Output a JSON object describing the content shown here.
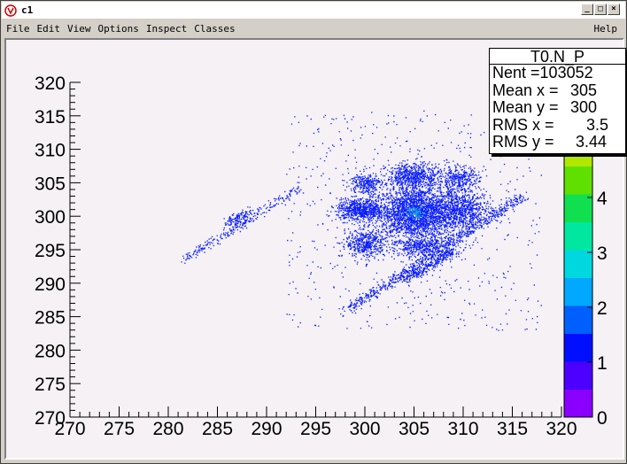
{
  "window": {
    "title": "c1",
    "controls": [
      "_",
      "□",
      "×"
    ]
  },
  "menubar": {
    "items": [
      {
        "label": "File",
        "name": "menu-file"
      },
      {
        "label": "Edit",
        "name": "menu-edit"
      },
      {
        "label": "View",
        "name": "menu-view"
      },
      {
        "label": "Options",
        "name": "menu-options"
      },
      {
        "label": "Inspect",
        "name": "menu-inspect"
      },
      {
        "label": "Classes",
        "name": "menu-classes"
      }
    ],
    "help": "Help"
  },
  "stats": {
    "title": "T0.N_P",
    "rows": [
      {
        "label": "Nent = ",
        "value": "103052"
      },
      {
        "label": "Mean x = ",
        "value": "305"
      },
      {
        "label": "Mean y = ",
        "value": "300"
      },
      {
        "label": "RMS x = ",
        "value": "3.5"
      },
      {
        "label": "RMS y = ",
        "value": "3.44"
      }
    ]
  },
  "colors": {
    "canvas_bg": "#f5f1f5",
    "point_color": "#0a1eff",
    "dense_color": "#1a9fd8"
  },
  "chart_data": {
    "type": "heatmap",
    "title": "",
    "xlabel": "",
    "ylabel": "",
    "xlim": [
      270,
      320
    ],
    "ylim": [
      270,
      320
    ],
    "x_ticks": [
      "270",
      "275",
      "280",
      "285",
      "290",
      "295",
      "300",
      "305",
      "310",
      "315",
      "320"
    ],
    "y_ticks": [
      "270",
      "275",
      "280",
      "285",
      "290",
      "295",
      "300",
      "305",
      "310",
      "315",
      "320"
    ],
    "colorbar": {
      "min": 0,
      "max": 5,
      "ticks": [
        "0",
        "1",
        "2",
        "3",
        "4",
        "5"
      ]
    },
    "grid": false,
    "clusters": [
      {
        "cx": 305.2,
        "cy": 300.5,
        "sx": 2.2,
        "sy": 2.0,
        "n": 2600
      },
      {
        "cx": 299.5,
        "cy": 301.0,
        "sx": 1.2,
        "sy": 0.8,
        "n": 700
      },
      {
        "cx": 305.0,
        "cy": 306.0,
        "sx": 1.4,
        "sy": 1.0,
        "n": 650
      },
      {
        "cx": 309.5,
        "cy": 305.5,
        "sx": 1.0,
        "sy": 1.0,
        "n": 350
      },
      {
        "cx": 300.0,
        "cy": 296.0,
        "sx": 1.0,
        "sy": 1.0,
        "n": 420
      },
      {
        "cx": 310.0,
        "cy": 301.0,
        "sx": 1.4,
        "sy": 1.3,
        "n": 650
      },
      {
        "cx": 300.0,
        "cy": 305.0,
        "sx": 0.8,
        "sy": 0.8,
        "n": 250
      },
      {
        "cx": 306.0,
        "cy": 295.5,
        "sx": 1.8,
        "sy": 0.8,
        "n": 500
      }
    ],
    "streaks": [
      {
        "x1": 281.5,
        "y1": 293.5,
        "x2": 293.5,
        "y2": 304.5,
        "n": 260
      },
      {
        "x1": 286.0,
        "y1": 299.0,
        "x2": 288.5,
        "y2": 301.0,
        "n": 120
      },
      {
        "x1": 298.0,
        "y1": 286.0,
        "x2": 316.0,
        "y2": 303.0,
        "n": 700
      },
      {
        "x1": 304.0,
        "y1": 290.5,
        "x2": 309.0,
        "y2": 295.0,
        "n": 300
      }
    ],
    "background_noise": {
      "xlim": [
        292,
        318
      ],
      "ylim": [
        283,
        316
      ],
      "n": 600
    },
    "hotspot": {
      "x": 305.0,
      "y": 300.7
    }
  }
}
